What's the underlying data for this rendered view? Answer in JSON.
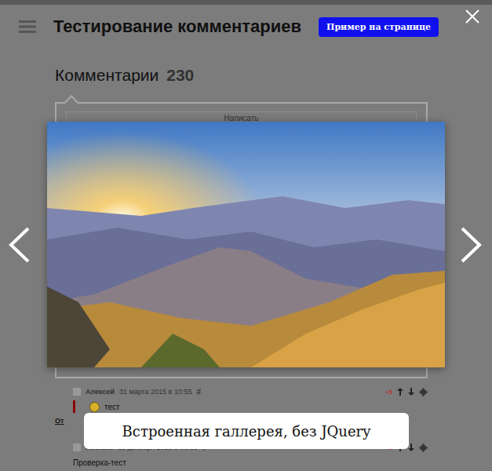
{
  "header": {
    "title": "Тестирование комментариев",
    "button": "Пример на странице"
  },
  "comments_heading": {
    "title": "Комментарии",
    "count": "230"
  },
  "editor": {
    "placeholder": "Написать"
  },
  "comments": [
    {
      "author": "Алексей",
      "date": "31 марта 2015 в 10:55",
      "anchor": "#",
      "score": "+5",
      "text": "тест",
      "reply": "От"
    },
    {
      "author": "Аноним",
      "date": "15 декабря 2015 в 08:35",
      "anchor": "#",
      "score": "+2",
      "text": "Проверка-тест"
    }
  ],
  "lightbox": {
    "caption": "Встроенная галлерея, без JQuery"
  }
}
